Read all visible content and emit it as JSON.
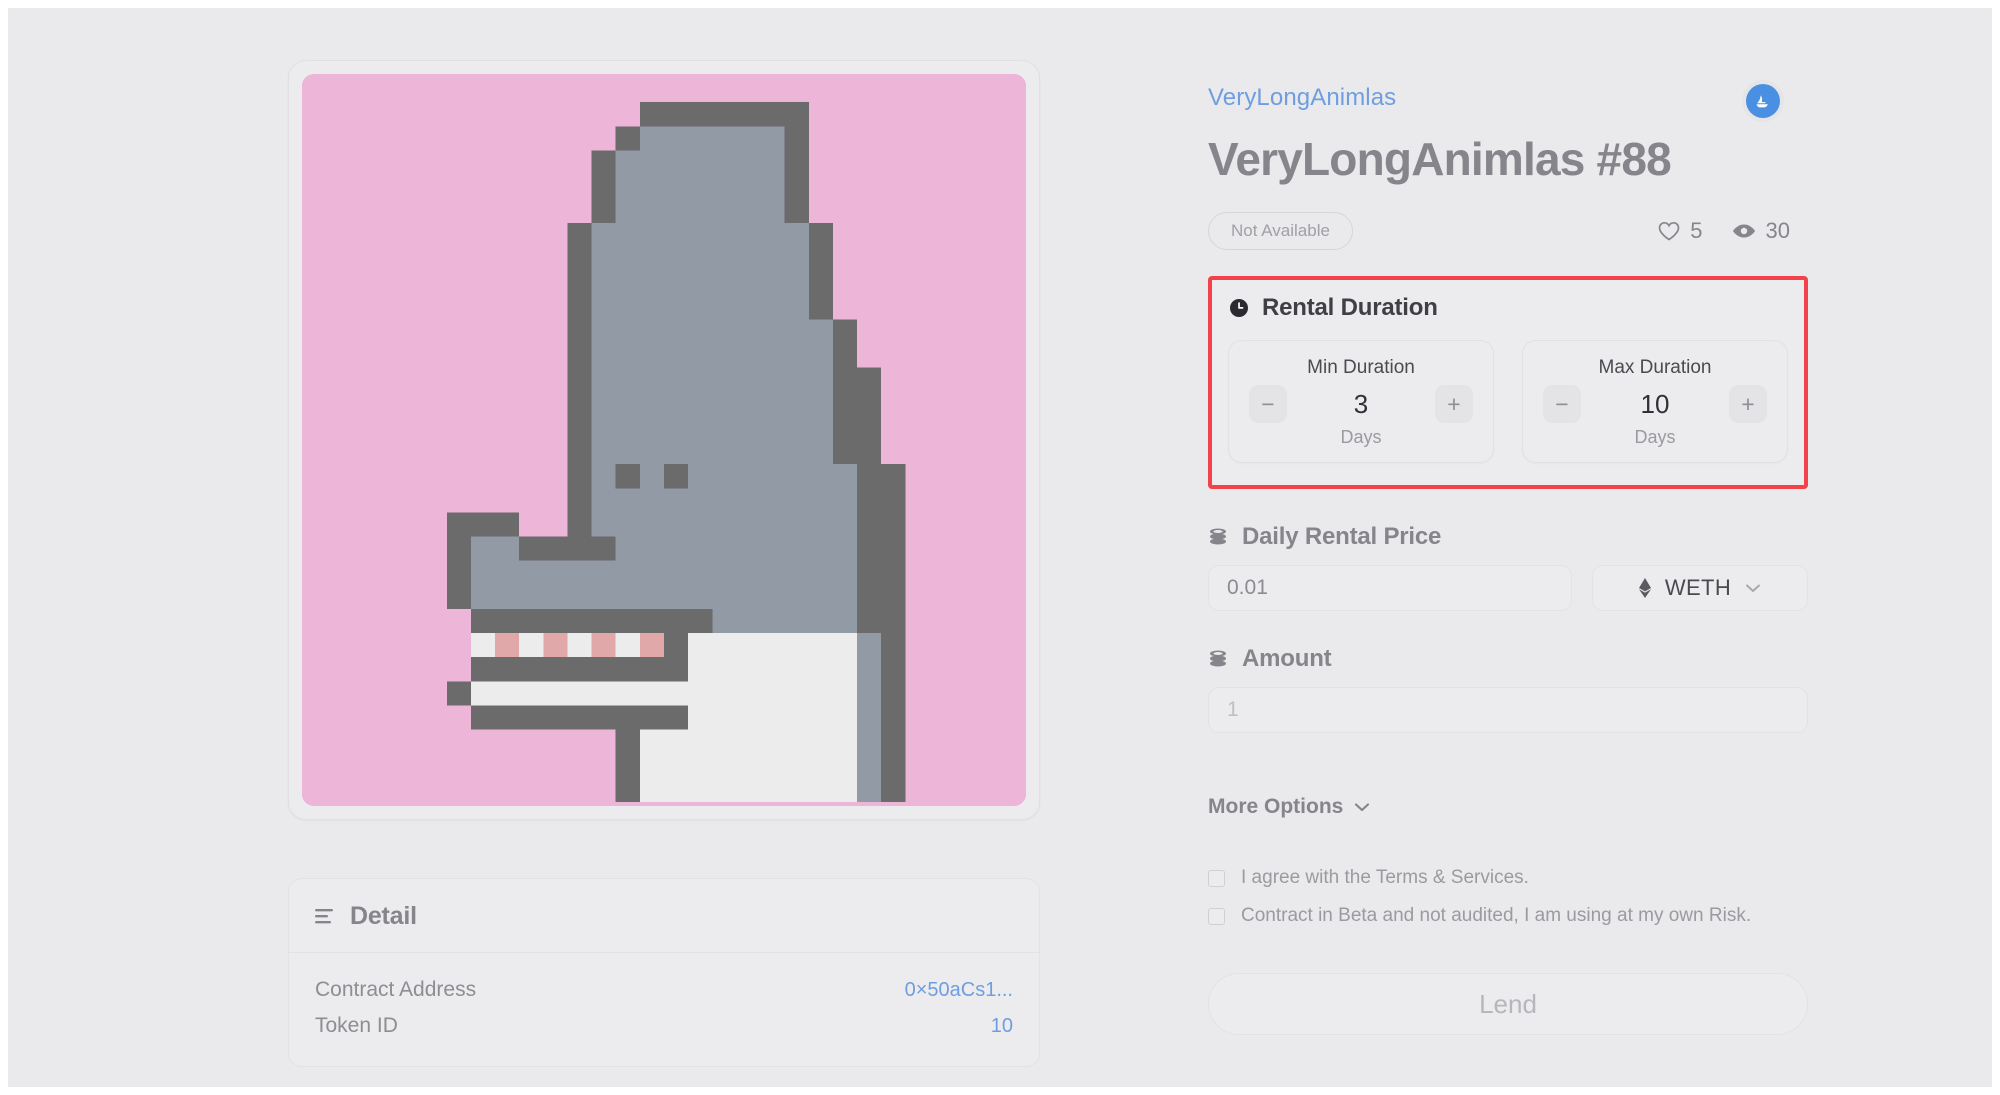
{
  "artwork": {
    "name": "verylonganimlas-88-pixel-art",
    "background_color": "#edb6d8",
    "body_color": "#929aa6",
    "outline_color": "#6b6b6b",
    "belly_color": "#ececec",
    "tooth_white": "#ececec",
    "tooth_pink": "#e0a8a8"
  },
  "detail": {
    "title": "Detail",
    "rows": [
      {
        "key": "Contract Address",
        "value": "0×50aCs1..."
      },
      {
        "key": "Token ID",
        "value": "10"
      }
    ]
  },
  "header": {
    "collection": "VeryLongAnimlas",
    "title": "VeryLongAnimlas #88",
    "status": "Not Available",
    "likes": "5",
    "views": "30",
    "marketplace_badge": "opensea-icon"
  },
  "rental": {
    "section_label": "Rental Duration",
    "highlight_color": "#f4424d",
    "min": {
      "caption": "Min Duration",
      "value": "3",
      "unit": "Days",
      "decrement": "−",
      "increment": "+"
    },
    "max": {
      "caption": "Max Duration",
      "value": "10",
      "unit": "Days",
      "decrement": "−",
      "increment": "+"
    }
  },
  "price": {
    "label": "Daily Rental Price",
    "value": "0.01",
    "placeholder": "0.01",
    "token": "WETH",
    "token_icon": "ethereum-icon"
  },
  "amount": {
    "label": "Amount",
    "value": "",
    "placeholder": "1"
  },
  "more_options": {
    "label": "More Options"
  },
  "terms": [
    {
      "text": "I agree with the Terms & Services.",
      "checked": false
    },
    {
      "text": "Contract in Beta and not audited, I am using at my own Risk.",
      "checked": false
    }
  ],
  "action": {
    "lend_label": "Lend"
  }
}
